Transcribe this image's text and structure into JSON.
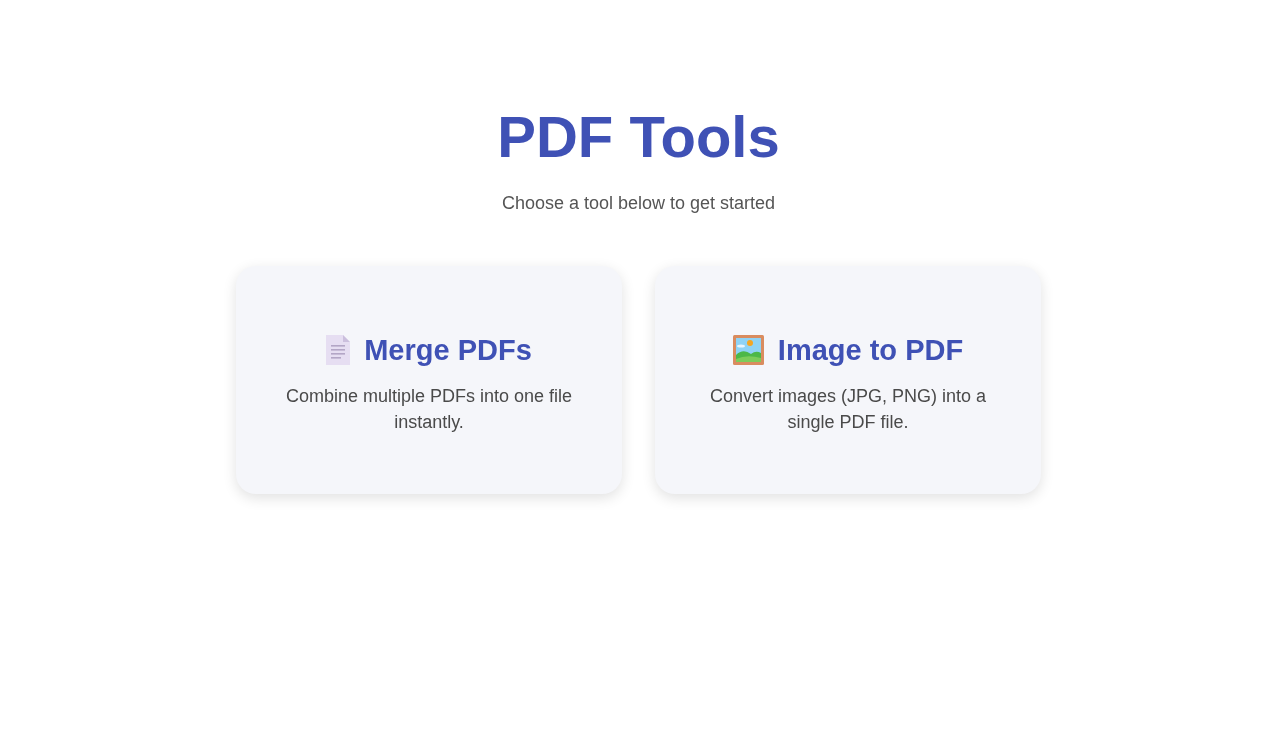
{
  "header": {
    "title": "PDF Tools",
    "subtitle": "Choose a tool below to get started"
  },
  "tools": [
    {
      "kind": "document",
      "title": "Merge PDFs",
      "description": "Combine multiple PDFs into one file instantly."
    },
    {
      "kind": "picture",
      "title": "Image to PDF",
      "description": "Convert images (JPG, PNG) into a single PDF file."
    }
  ]
}
